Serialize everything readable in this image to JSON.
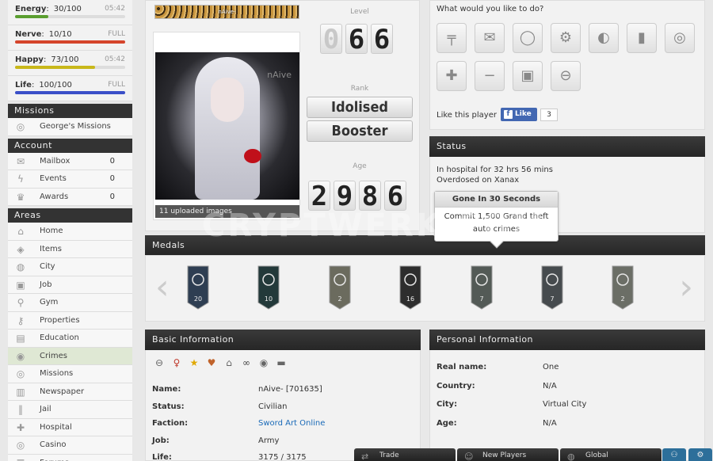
{
  "bars": [
    {
      "name": "Energy",
      "value": "30/100",
      "right": "05:42",
      "fill": 0.3,
      "color": "#5a9e2f"
    },
    {
      "name": "Nerve",
      "value": "10/10",
      "right": "FULL",
      "fill": 1.0,
      "color": "#d5452c"
    },
    {
      "name": "Happy",
      "value": "73/100",
      "right": "05:42",
      "fill": 0.73,
      "color": "#c8b81a"
    },
    {
      "name": "Life",
      "value": "100/100",
      "right": "FULL",
      "fill": 1.0,
      "color": "#3a4fc8"
    }
  ],
  "sidebar": {
    "missions_head": "Missions",
    "missions": [
      {
        "label": "George's Missions",
        "icon": "target-icon"
      }
    ],
    "account_head": "Account",
    "account": [
      {
        "label": "Mailbox",
        "count": "0",
        "icon": "mail-icon"
      },
      {
        "label": "Events",
        "count": "0",
        "icon": "lightning-icon"
      },
      {
        "label": "Awards",
        "count": "0",
        "icon": "trophy-icon"
      }
    ],
    "areas_head": "Areas",
    "areas": [
      {
        "label": "Home",
        "icon": "home-icon"
      },
      {
        "label": "Items",
        "icon": "cube-icon"
      },
      {
        "label": "City",
        "icon": "globe-icon"
      },
      {
        "label": "Job",
        "icon": "briefcase-icon"
      },
      {
        "label": "Gym",
        "icon": "dumbbell-icon"
      },
      {
        "label": "Properties",
        "icon": "key-icon"
      },
      {
        "label": "Education",
        "icon": "book-icon"
      },
      {
        "label": "Crimes",
        "icon": "fingerprint-icon"
      },
      {
        "label": "Missions",
        "icon": "target-icon"
      },
      {
        "label": "Newspaper",
        "icon": "newspaper-icon"
      },
      {
        "label": "Jail",
        "icon": "bars-icon"
      },
      {
        "label": "Hospital",
        "icon": "cross-icon"
      },
      {
        "label": "Casino",
        "icon": "chip-icon"
      },
      {
        "label": "Forums",
        "icon": "chat-icon"
      }
    ]
  },
  "profile": {
    "banner_text": "nAive-",
    "signature": "nAive",
    "uploads": "11 uploaded images",
    "level_label": "Level",
    "level_digits": [
      "0",
      "6",
      "6"
    ],
    "rank_label": "Rank",
    "rank_1": "Idolised",
    "rank_2": "Booster",
    "age_label": "Age",
    "age_digits": [
      "2",
      "9",
      "8",
      "6"
    ]
  },
  "actions": {
    "prompt": "What would you like to do?",
    "buttons": [
      "gun-icon",
      "envelope-icon",
      "speech-bubble-icon",
      "money-icon",
      "steal-icon",
      "bar-chart-icon",
      "target-icon",
      "add-friend-icon",
      "add-enemy-icon",
      "briefcase-icon",
      "no-entry-icon"
    ],
    "like_text": "Like this player",
    "like_label": "Like",
    "like_count": "3"
  },
  "status": {
    "title": "Status",
    "line1": "In hospital for 32 hrs 56 mins",
    "line2": "Overdosed on Xanax",
    "tooltip_title": "Gone In 30 Seconds",
    "tooltip_line1": "Commit 1,500 Grand theft",
    "tooltip_line2": "auto crimes"
  },
  "medals": {
    "title": "Medals",
    "items": [
      {
        "icon": "stars-icon",
        "num": "20",
        "color": "#2e3e52"
      },
      {
        "icon": "gun-icon",
        "num": "10",
        "color": "#23393a"
      },
      {
        "icon": "handcuffs-icon",
        "num": "2",
        "color": "#6b6b5e"
      },
      {
        "icon": "fire-icon",
        "num": "16",
        "color": "#2d2d2d"
      },
      {
        "icon": "steering-wheel-icon",
        "num": "7",
        "color": "#535a56"
      },
      {
        "icon": "computer-icon",
        "num": "7",
        "color": "#464b4e"
      },
      {
        "icon": "leaf-icon",
        "num": "2",
        "color": "#6b6e66"
      }
    ]
  },
  "basic": {
    "title": "Basic Information",
    "icons": [
      "minus-icon",
      "female-icon",
      "star-icon",
      "heart-icon",
      "house-icon",
      "link-icon",
      "coin-icon",
      "bed-icon"
    ],
    "rows": [
      {
        "label": "Name:",
        "value": "nAive- [701635]"
      },
      {
        "label": "Status:",
        "value": "Civilian"
      },
      {
        "label": "Faction:",
        "value": "Sword Art Online"
      },
      {
        "label": "Job:",
        "value": "Army"
      },
      {
        "label": "Life:",
        "value": "3175 / 3175"
      }
    ]
  },
  "personal": {
    "title": "Personal Information",
    "rows": [
      {
        "label": "Real name:",
        "value": "One"
      },
      {
        "label": "Country:",
        "value": "N/A"
      },
      {
        "label": "City:",
        "value": "Virtual City"
      },
      {
        "label": "Age:",
        "value": "N/A"
      }
    ]
  },
  "footer": {
    "tabs": [
      {
        "label": "Trade",
        "icon": "trade-icon"
      },
      {
        "label": "New Players",
        "icon": "new-players-icon"
      },
      {
        "label": "Global",
        "icon": "globe-icon"
      }
    ],
    "squares": [
      "people-icon",
      "settings-icon"
    ]
  },
  "watermark": "CRYPTWERK.COM"
}
